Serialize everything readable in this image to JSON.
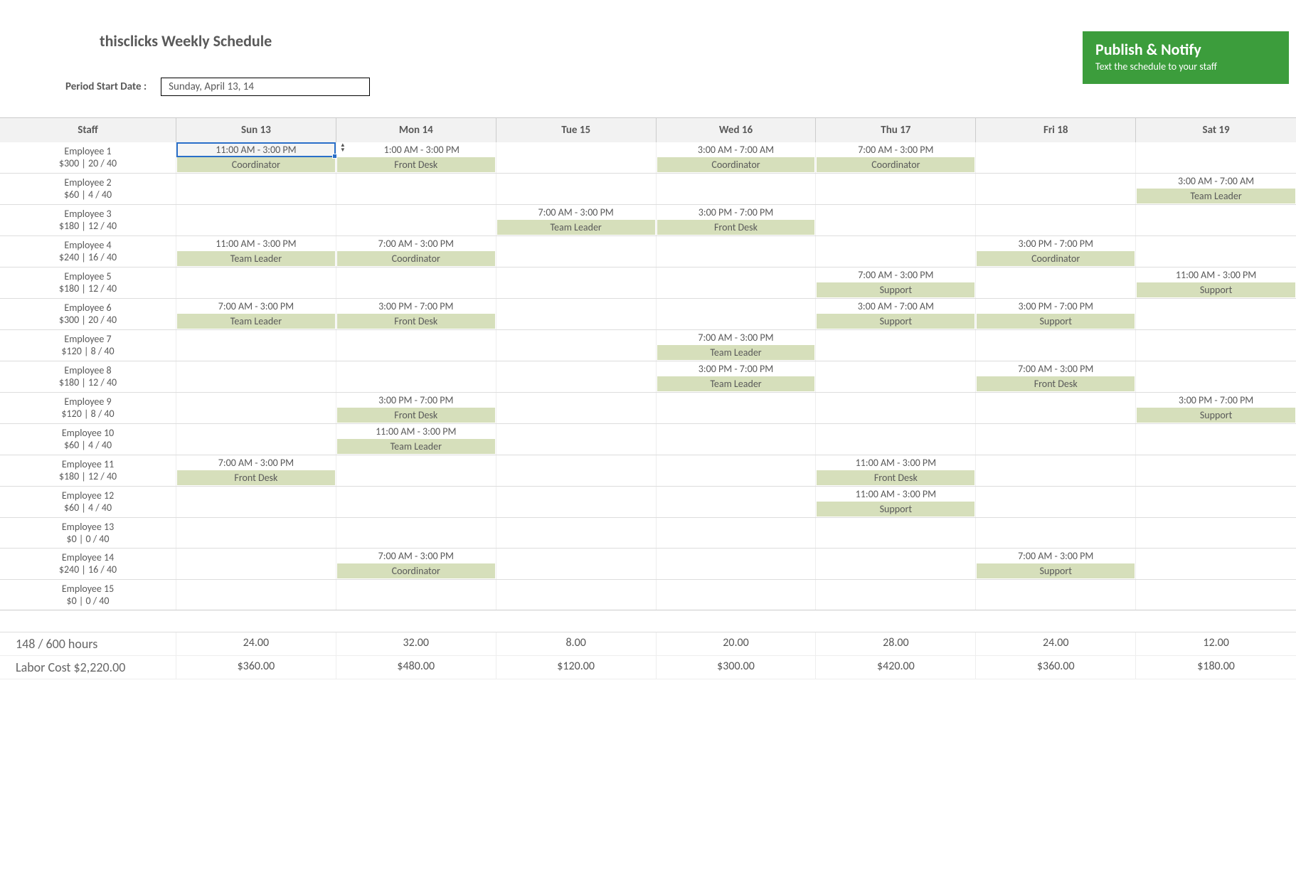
{
  "title": "thisclicks Weekly Schedule",
  "period_label": "Period Start Date :",
  "period_value": "Sunday, April 13, 14",
  "publish": {
    "title": "Publish & Notify",
    "subtitle": "Text the schedule to your staff"
  },
  "columns": {
    "staff": "Staff",
    "days": [
      "Sun 13",
      "Mon 14",
      "Tue 15",
      "Wed 16",
      "Thu 17",
      "Fri 18",
      "Sat 19"
    ]
  },
  "employees": [
    {
      "name": "Employee 1",
      "stats": "$300 | 20 / 40",
      "shifts": [
        {
          "time": "11:00 AM - 3:00 PM",
          "role": "Coordinator",
          "selected": true
        },
        {
          "time": "1:00 AM - 3:00 PM",
          "role": "Front Desk",
          "stepper": true
        },
        null,
        {
          "time": "3:00 AM - 7:00 AM",
          "role": "Coordinator"
        },
        {
          "time": "7:00 AM - 3:00 PM",
          "role": "Coordinator"
        },
        null,
        null
      ]
    },
    {
      "name": "Employee 2",
      "stats": "$60 | 4 / 40",
      "shifts": [
        null,
        null,
        null,
        null,
        null,
        null,
        {
          "time": "3:00 AM - 7:00 AM",
          "role": "Team Leader"
        }
      ]
    },
    {
      "name": "Employee 3",
      "stats": "$180 | 12 / 40",
      "shifts": [
        null,
        null,
        {
          "time": "7:00 AM - 3:00 PM",
          "role": "Team Leader"
        },
        {
          "time": "3:00 PM - 7:00 PM",
          "role": "Front Desk"
        },
        null,
        null,
        null
      ]
    },
    {
      "name": "Employee 4",
      "stats": "$240 | 16 / 40",
      "shifts": [
        {
          "time": "11:00 AM - 3:00 PM",
          "role": "Team Leader"
        },
        {
          "time": "7:00 AM - 3:00 PM",
          "role": "Coordinator"
        },
        null,
        null,
        null,
        {
          "time": "3:00 PM - 7:00 PM",
          "role": "Coordinator"
        },
        null
      ]
    },
    {
      "name": "Employee 5",
      "stats": "$180 | 12 / 40",
      "shifts": [
        null,
        null,
        null,
        null,
        {
          "time": "7:00 AM - 3:00 PM",
          "role": "Support"
        },
        null,
        {
          "time": "11:00 AM - 3:00 PM",
          "role": "Support"
        }
      ]
    },
    {
      "name": "Employee 6",
      "stats": "$300 | 20 / 40",
      "shifts": [
        {
          "time": "7:00 AM - 3:00 PM",
          "role": "Team Leader"
        },
        {
          "time": "3:00 PM - 7:00 PM",
          "role": "Front Desk"
        },
        null,
        null,
        {
          "time": "3:00 AM - 7:00 AM",
          "role": "Support"
        },
        {
          "time": "3:00 PM - 7:00 PM",
          "role": "Support"
        },
        null
      ]
    },
    {
      "name": "Employee 7",
      "stats": "$120 | 8 / 40",
      "shifts": [
        null,
        null,
        null,
        {
          "time": "7:00 AM - 3:00 PM",
          "role": "Team Leader"
        },
        null,
        null,
        null
      ]
    },
    {
      "name": "Employee 8",
      "stats": "$180 | 12 / 40",
      "shifts": [
        null,
        null,
        null,
        {
          "time": "3:00 PM - 7:00 PM",
          "role": "Team Leader"
        },
        null,
        {
          "time": "7:00 AM - 3:00 PM",
          "role": "Front Desk"
        },
        null
      ]
    },
    {
      "name": "Employee 9",
      "stats": "$120 | 8 / 40",
      "shifts": [
        null,
        {
          "time": "3:00 PM - 7:00 PM",
          "role": "Front Desk"
        },
        null,
        null,
        null,
        null,
        {
          "time": "3:00 PM - 7:00 PM",
          "role": "Support"
        }
      ]
    },
    {
      "name": "Employee 10",
      "stats": "$60 | 4 / 40",
      "shifts": [
        null,
        {
          "time": "11:00 AM - 3:00 PM",
          "role": "Team Leader"
        },
        null,
        null,
        null,
        null,
        null
      ]
    },
    {
      "name": "Employee 11",
      "stats": "$180 | 12 / 40",
      "shifts": [
        {
          "time": "7:00 AM - 3:00 PM",
          "role": "Front Desk"
        },
        null,
        null,
        null,
        {
          "time": "11:00 AM - 3:00 PM",
          "role": "Front Desk"
        },
        null,
        null
      ]
    },
    {
      "name": "Employee 12",
      "stats": "$60 | 4 / 40",
      "shifts": [
        null,
        null,
        null,
        null,
        {
          "time": "11:00 AM - 3:00 PM",
          "role": "Support"
        },
        null,
        null
      ]
    },
    {
      "name": "Employee 13",
      "stats": "$0 | 0 / 40",
      "shifts": [
        null,
        null,
        null,
        null,
        null,
        null,
        null
      ]
    },
    {
      "name": "Employee 14",
      "stats": "$240 | 16 / 40",
      "shifts": [
        null,
        {
          "time": "7:00 AM - 3:00 PM",
          "role": "Coordinator"
        },
        null,
        null,
        null,
        {
          "time": "7:00 AM - 3:00 PM",
          "role": "Support"
        },
        null
      ]
    },
    {
      "name": "Employee 15",
      "stats": "$0 | 0 / 40",
      "shifts": [
        null,
        null,
        null,
        null,
        null,
        null,
        null
      ]
    }
  ],
  "summary": {
    "hours_label": "148 / 600 hours",
    "hours_by_day": [
      "24.00",
      "32.00",
      "8.00",
      "20.00",
      "28.00",
      "24.00",
      "12.00"
    ],
    "cost_label": "Labor Cost $2,220.00",
    "cost_by_day": [
      "$360.00",
      "$480.00",
      "$120.00",
      "$300.00",
      "$420.00",
      "$360.00",
      "$180.00"
    ]
  }
}
